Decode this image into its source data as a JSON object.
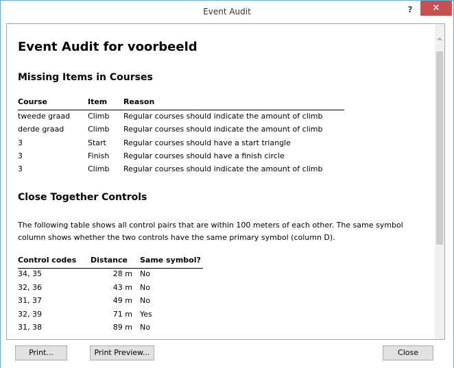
{
  "window": {
    "title": "Event Audit",
    "help_label": "?",
    "close_label": "×"
  },
  "report": {
    "title": "Event Audit for voorbeeld",
    "missing": {
      "heading": "Missing Items in Courses",
      "headers": [
        "Course",
        "Item",
        "Reason"
      ],
      "rows": [
        [
          "tweede graad",
          "Climb",
          "Regular courses should indicate the amount of climb"
        ],
        [
          "derde graad",
          "Climb",
          "Regular courses should indicate the amount of climb"
        ],
        [
          "3",
          "Start",
          "Regular courses should have a start triangle"
        ],
        [
          "3",
          "Finish",
          "Regular courses should have a finish circle"
        ],
        [
          "3",
          "Climb",
          "Regular courses should indicate the amount of climb"
        ]
      ]
    },
    "close": {
      "heading": "Close Together Controls",
      "description": "The following table shows all control pairs that are within 100 meters of each other. The same symbol column shows whether the two controls have the same primary symbol (column D).",
      "headers": [
        "Control codes",
        "Distance",
        "Same symbol?"
      ],
      "rows": [
        [
          "34, 35",
          "28 m",
          "No"
        ],
        [
          "32, 36",
          "43 m",
          "No"
        ],
        [
          "31, 37",
          "49 m",
          "No"
        ],
        [
          "32, 39",
          "71 m",
          "Yes"
        ],
        [
          "31, 38",
          "89 m",
          "No"
        ]
      ]
    }
  },
  "scrollbar": {
    "up_icon": "^",
    "down_icon": "v"
  },
  "buttons": {
    "print": "Print...",
    "print_preview": "Print Preview...",
    "close": "Close"
  }
}
